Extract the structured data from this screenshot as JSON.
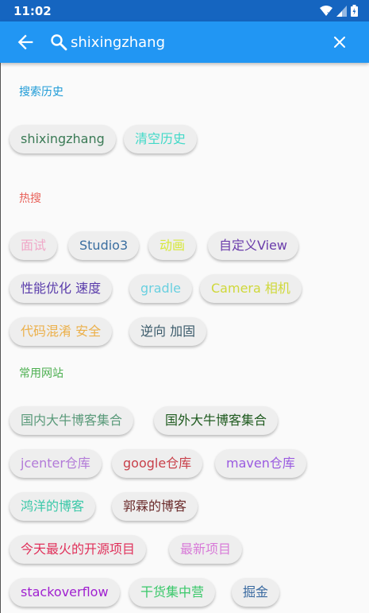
{
  "status_bar": {
    "time": "11:02"
  },
  "search": {
    "query": "shixingzhang"
  },
  "sections": {
    "history": {
      "title": "搜索历史",
      "color": "#1e9bd7"
    },
    "hot": {
      "title": "热搜",
      "color": "#e8625a"
    },
    "sites": {
      "title": "常用网站",
      "color": "#4caf50"
    }
  },
  "history_chips": [
    {
      "label": "shixingzhang",
      "color": "#3a7a55"
    },
    {
      "label": "清空历史",
      "color": "#41d9c8"
    }
  ],
  "hot_chips": [
    {
      "label": "面试",
      "color": "#f0a8c8"
    },
    {
      "label": "Studio3",
      "color": "#3a6ea0"
    },
    {
      "label": "动画",
      "color": "#d7e83a"
    },
    {
      "label": "自定义View",
      "color": "#6a3cab"
    },
    {
      "label": "性能优化 速度",
      "color": "#5a3cab"
    },
    {
      "label": "gradle",
      "color": "#6ad0e0"
    },
    {
      "label": "Camera 相机",
      "color": "#cfd83a"
    },
    {
      "label": "代码混淆 安全",
      "color": "#ecb04a"
    },
    {
      "label": "逆向 加固",
      "color": "#3a5a6a"
    }
  ],
  "site_chips": [
    {
      "label": "国内大牛博客集合",
      "color": "#5a9a7a"
    },
    {
      "label": "国外大牛博客集合",
      "color": "#1e5a1e"
    },
    {
      "label": "jcenter仓库",
      "color": "#b27ad8"
    },
    {
      "label": "google仓库",
      "color": "#c8404a"
    },
    {
      "label": "maven仓库",
      "color": "#9a5ae0"
    },
    {
      "label": "鸿洋的博客",
      "color": "#3ac8a8"
    },
    {
      "label": "郭霖的博客",
      "color": "#6a2a2a"
    },
    {
      "label": "今天最火的开源项目",
      "color": "#e0305a"
    },
    {
      "label": "最新项目",
      "color": "#d87ad8"
    },
    {
      "label": "stackoverflow",
      "color": "#a020d0"
    },
    {
      "label": "干货集中营",
      "color": "#3ac86a"
    },
    {
      "label": "掘金",
      "color": "#3a6aa0"
    }
  ]
}
